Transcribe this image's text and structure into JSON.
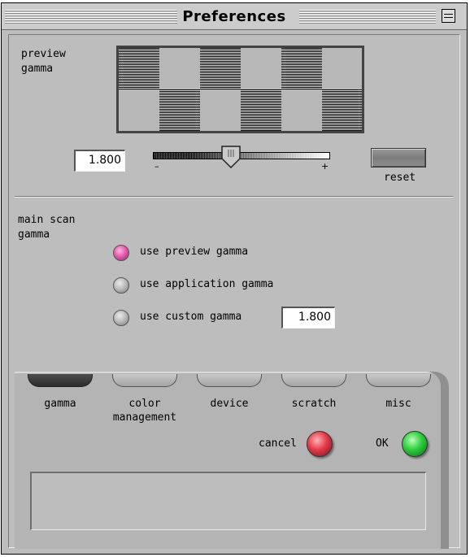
{
  "window": {
    "title": "Preferences"
  },
  "preview": {
    "label_line1": "preview",
    "label_line2": "gamma",
    "gamma_value": "1.800",
    "slider": {
      "min_label": "–",
      "max_label": "+",
      "value_fraction": 0.44
    },
    "reset_label": "reset"
  },
  "main_scan": {
    "label_line1": "main scan",
    "label_line2": "gamma",
    "options": [
      {
        "label": "use preview gamma",
        "selected": true
      },
      {
        "label": "use application gamma",
        "selected": false
      },
      {
        "label": "use custom gamma",
        "selected": false
      }
    ],
    "custom_value": "1.800"
  },
  "tabs": [
    {
      "label": "gamma",
      "active": true
    },
    {
      "label_line1": "color",
      "label_line2": "management",
      "active": false
    },
    {
      "label": "device",
      "active": false
    },
    {
      "label": "scratch",
      "active": false
    },
    {
      "label": "misc",
      "active": false
    }
  ],
  "buttons": {
    "cancel_label": "cancel",
    "ok_label": "OK"
  },
  "colors": {
    "window_bg": "#bdbdbd",
    "radio_selected": "#e056a8",
    "cancel": "#e23a4a",
    "ok": "#2dcc3a"
  }
}
